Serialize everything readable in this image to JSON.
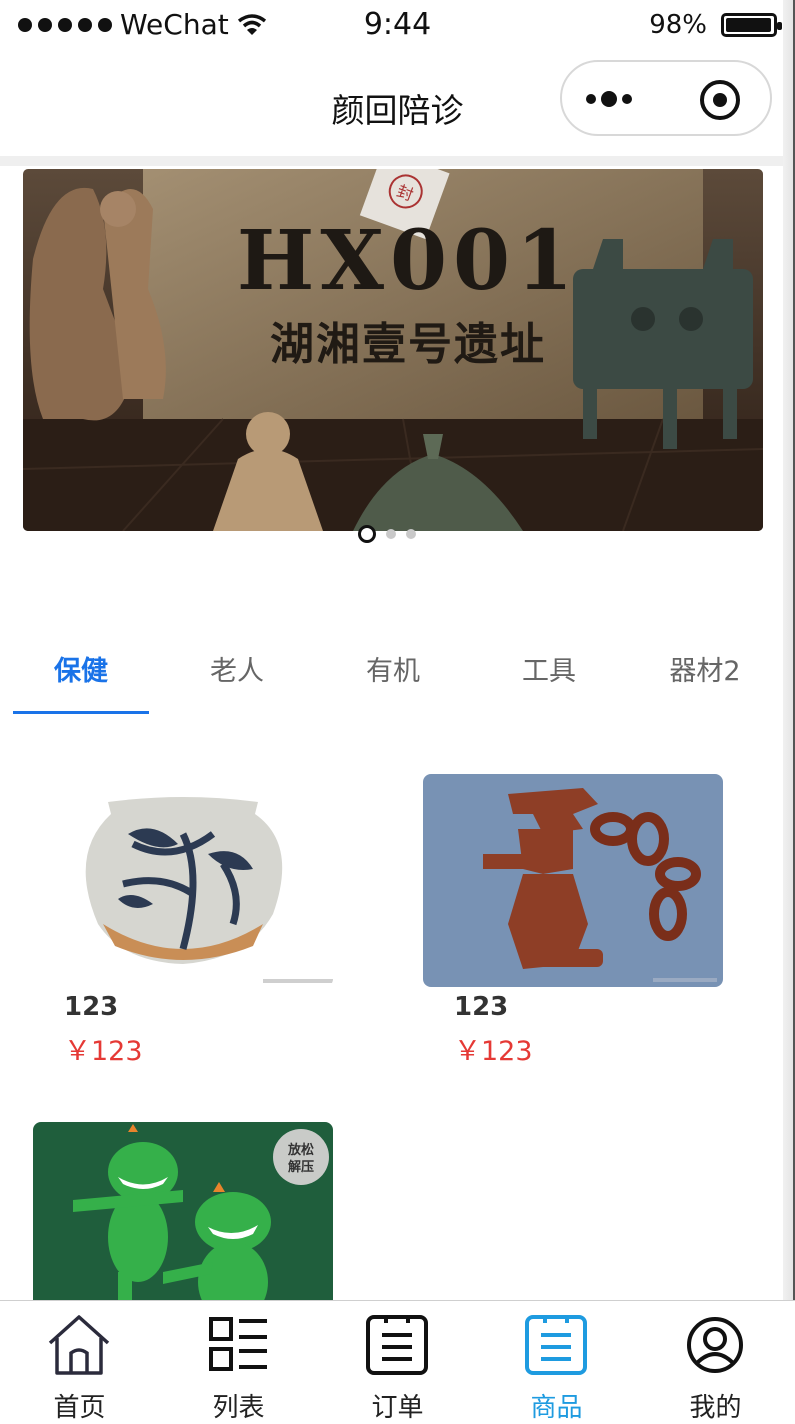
{
  "status_bar": {
    "carrier": "WeChat",
    "time": "9:44",
    "battery": "98%",
    "battery_level": 0.98
  },
  "nav": {
    "title": "颜回陪诊"
  },
  "banner": {
    "code": "HX001",
    "subtitle": "湖湘壹号遗址",
    "seal": "封",
    "slides": 3,
    "active_slide": 0
  },
  "tabs": [
    {
      "label": "保健",
      "active": true
    },
    {
      "label": "老人",
      "active": false
    },
    {
      "label": "有机",
      "active": false
    },
    {
      "label": "工具",
      "active": false
    },
    {
      "label": "器材2",
      "active": false
    }
  ],
  "products": [
    {
      "name": "123",
      "price": "￥123",
      "image": "blue-white-porcelain-jar"
    },
    {
      "name": "123",
      "price": "￥123",
      "image": "red-jade-figure-with-chain"
    },
    {
      "name": "",
      "price": "",
      "image": "green-dinosaur-toys",
      "badge": "放松解压"
    }
  ],
  "tabbar": [
    {
      "label": "首页",
      "icon": "home-icon",
      "active": false
    },
    {
      "label": "列表",
      "icon": "list-icon",
      "active": false
    },
    {
      "label": "订单",
      "icon": "order-icon",
      "active": false
    },
    {
      "label": "商品",
      "icon": "goods-icon",
      "active": true
    },
    {
      "label": "我的",
      "icon": "profile-icon",
      "active": false
    }
  ],
  "colors": {
    "accent": "#1a73e8",
    "price": "#e53935",
    "tabbar_active": "#1e9be0"
  }
}
